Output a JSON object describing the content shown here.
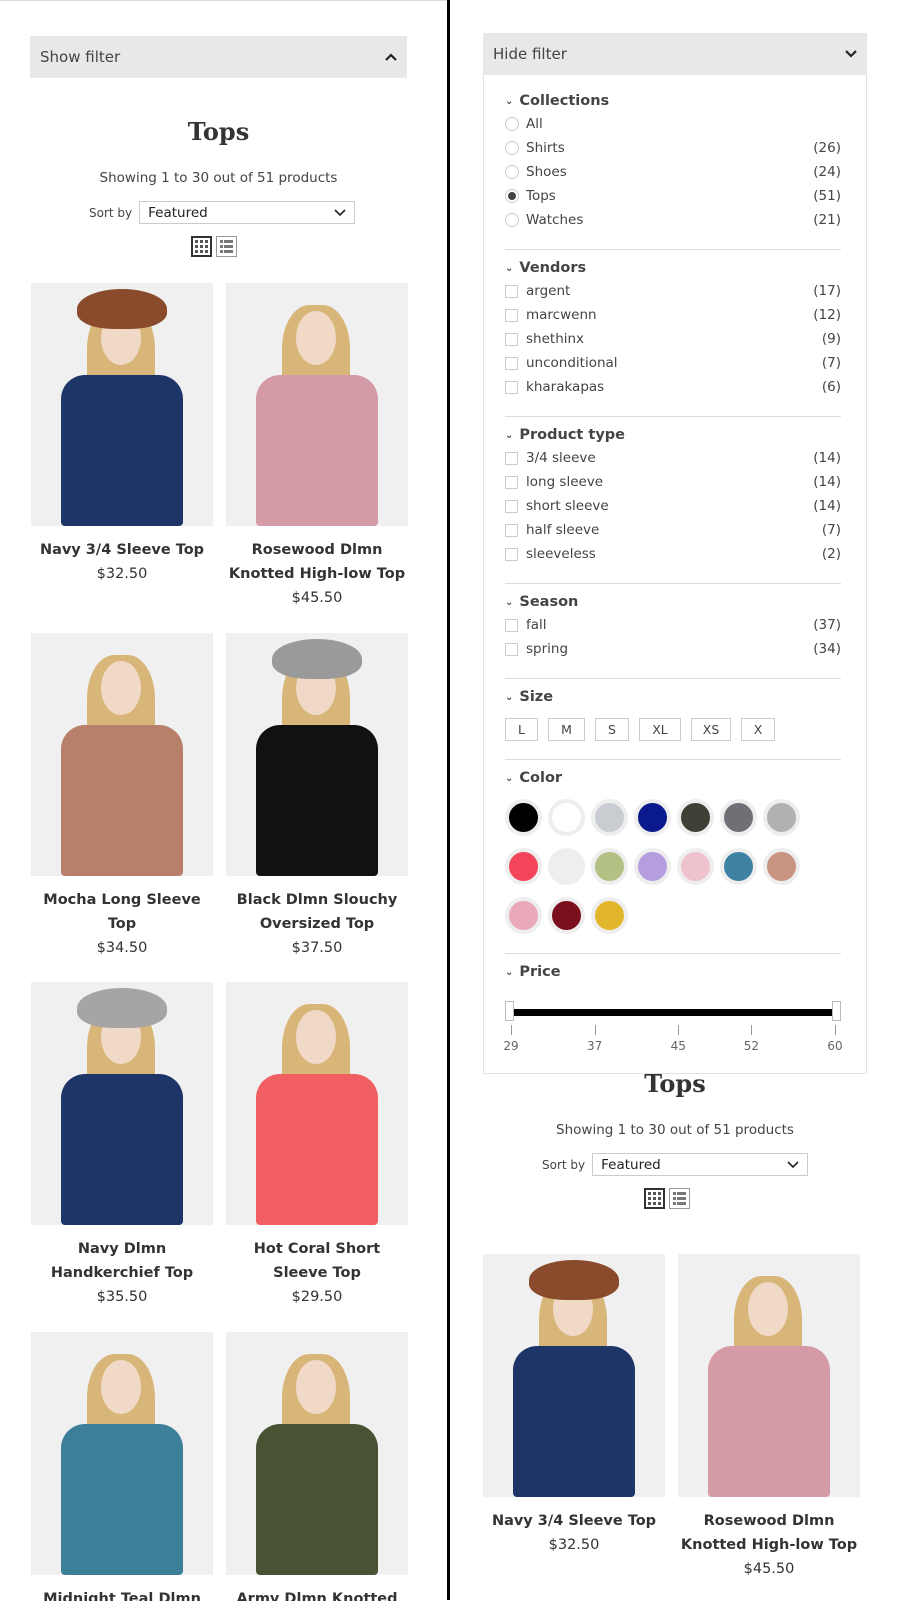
{
  "left": {
    "filter_toggle": "Show filter",
    "title": "Tops",
    "showing": "Showing 1 to 30 out of 51 products",
    "sort_label": "Sort by",
    "sort_value": "Featured",
    "products": [
      {
        "name": "Navy 3/4 Sleeve Top",
        "price": "$32.50",
        "color": "#1e3568",
        "hat": "#8a4b2d"
      },
      {
        "name": "Rosewood Dlmn Knotted High-low Top",
        "price": "$45.50",
        "color": "#d49aa5",
        "hat": ""
      },
      {
        "name": "Mocha Long Sleeve Top",
        "price": "$34.50",
        "color": "#b8806a",
        "hat": ""
      },
      {
        "name": "Black Dlmn Slouchy Oversized Top",
        "price": "$37.50",
        "color": "#111111",
        "hat": "#9a9a9a"
      },
      {
        "name": "Navy Dlmn Handkerchief Top",
        "price": "$35.50",
        "color": "#1e3568",
        "hat": "#a5a5a5"
      },
      {
        "name": "Hot Coral Short Sleeve Top",
        "price": "$29.50",
        "color": "#f15f63",
        "hat": ""
      },
      {
        "name": "Midnight Teal Dlmn",
        "price": "",
        "color": "#3d7f98",
        "hat": ""
      },
      {
        "name": "Army Dlmn Knotted",
        "price": "",
        "color": "#4a5234",
        "hat": ""
      }
    ]
  },
  "right": {
    "filter_toggle": "Hide filter",
    "collections": {
      "heading": "Collections",
      "items": [
        {
          "label": "All",
          "count": "",
          "selected": false
        },
        {
          "label": "Shirts",
          "count": "(26)",
          "selected": false
        },
        {
          "label": "Shoes",
          "count": "(24)",
          "selected": false
        },
        {
          "label": "Tops",
          "count": "(51)",
          "selected": true
        },
        {
          "label": "Watches",
          "count": "(21)",
          "selected": false
        }
      ]
    },
    "vendors": {
      "heading": "Vendors",
      "items": [
        {
          "label": "argent",
          "count": "(17)"
        },
        {
          "label": "marcwenn",
          "count": "(12)"
        },
        {
          "label": "shethinx",
          "count": "(9)"
        },
        {
          "label": "unconditional",
          "count": "(7)"
        },
        {
          "label": "kharakapas",
          "count": "(6)"
        }
      ]
    },
    "product_type": {
      "heading": "Product type",
      "items": [
        {
          "label": "3/4 sleeve",
          "count": "(14)"
        },
        {
          "label": "long sleeve",
          "count": "(14)"
        },
        {
          "label": "short sleeve",
          "count": "(14)"
        },
        {
          "label": "half sleeve",
          "count": "(7)"
        },
        {
          "label": "sleeveless",
          "count": "(2)"
        }
      ]
    },
    "season": {
      "heading": "Season",
      "items": [
        {
          "label": "fall",
          "count": "(37)"
        },
        {
          "label": "spring",
          "count": "(34)"
        }
      ]
    },
    "size": {
      "heading": "Size",
      "items": [
        "L",
        "M",
        "S",
        "XL",
        "XS",
        "X"
      ]
    },
    "color": {
      "heading": "Color",
      "swatches": [
        "#000000",
        "#ffffff",
        "#c9ccd1",
        "#0a1a8c",
        "#3e4136",
        "#6e7075",
        "#b3b0b2",
        "#f2445a",
        "#eeeeee",
        "#b3c184",
        "#b49ee0",
        "#eec3cd",
        "#3d82a3",
        "#c99480",
        "#e9a9b8",
        "#7a0f1e",
        "#e2b62b"
      ]
    },
    "price": {
      "heading": "Price",
      "min": 29,
      "max": 60,
      "ticks": [
        "29",
        "37",
        "45",
        "52",
        "60"
      ]
    },
    "title": "Tops",
    "showing": "Showing 1 to 30 out of 51 products",
    "sort_label": "Sort by",
    "sort_value": "Featured",
    "products": [
      {
        "name": "Navy 3/4 Sleeve Top",
        "price": "$32.50",
        "color": "#1e3568",
        "hat": "#8a4b2d"
      },
      {
        "name": "Rosewood Dlmn Knotted High-low Top",
        "price": "$45.50",
        "color": "#d49aa5",
        "hat": ""
      }
    ]
  }
}
